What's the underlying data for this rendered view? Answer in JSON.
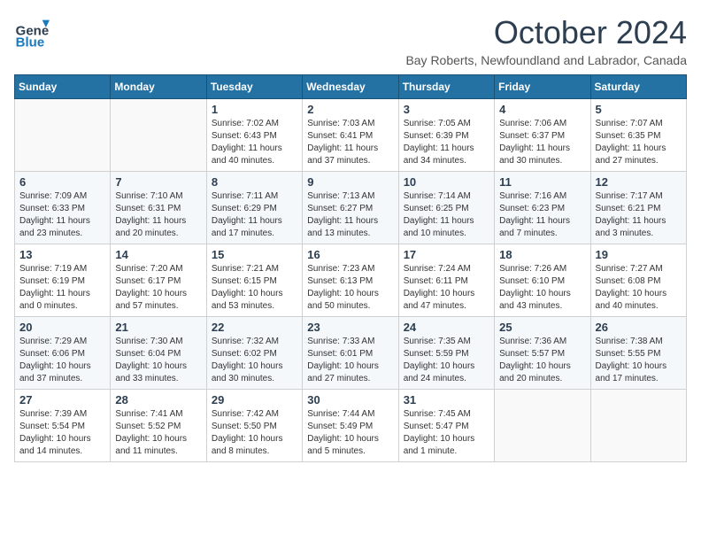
{
  "header": {
    "logo_general": "General",
    "logo_blue": "Blue",
    "month_title": "October 2024",
    "subtitle": "Bay Roberts, Newfoundland and Labrador, Canada"
  },
  "days_of_week": [
    "Sunday",
    "Monday",
    "Tuesday",
    "Wednesday",
    "Thursday",
    "Friday",
    "Saturday"
  ],
  "weeks": [
    [
      {
        "day": "",
        "info": ""
      },
      {
        "day": "",
        "info": ""
      },
      {
        "day": "1",
        "info": "Sunrise: 7:02 AM\nSunset: 6:43 PM\nDaylight: 11 hours and 40 minutes."
      },
      {
        "day": "2",
        "info": "Sunrise: 7:03 AM\nSunset: 6:41 PM\nDaylight: 11 hours and 37 minutes."
      },
      {
        "day": "3",
        "info": "Sunrise: 7:05 AM\nSunset: 6:39 PM\nDaylight: 11 hours and 34 minutes."
      },
      {
        "day": "4",
        "info": "Sunrise: 7:06 AM\nSunset: 6:37 PM\nDaylight: 11 hours and 30 minutes."
      },
      {
        "day": "5",
        "info": "Sunrise: 7:07 AM\nSunset: 6:35 PM\nDaylight: 11 hours and 27 minutes."
      }
    ],
    [
      {
        "day": "6",
        "info": "Sunrise: 7:09 AM\nSunset: 6:33 PM\nDaylight: 11 hours and 23 minutes."
      },
      {
        "day": "7",
        "info": "Sunrise: 7:10 AM\nSunset: 6:31 PM\nDaylight: 11 hours and 20 minutes."
      },
      {
        "day": "8",
        "info": "Sunrise: 7:11 AM\nSunset: 6:29 PM\nDaylight: 11 hours and 17 minutes."
      },
      {
        "day": "9",
        "info": "Sunrise: 7:13 AM\nSunset: 6:27 PM\nDaylight: 11 hours and 13 minutes."
      },
      {
        "day": "10",
        "info": "Sunrise: 7:14 AM\nSunset: 6:25 PM\nDaylight: 11 hours and 10 minutes."
      },
      {
        "day": "11",
        "info": "Sunrise: 7:16 AM\nSunset: 6:23 PM\nDaylight: 11 hours and 7 minutes."
      },
      {
        "day": "12",
        "info": "Sunrise: 7:17 AM\nSunset: 6:21 PM\nDaylight: 11 hours and 3 minutes."
      }
    ],
    [
      {
        "day": "13",
        "info": "Sunrise: 7:19 AM\nSunset: 6:19 PM\nDaylight: 11 hours and 0 minutes."
      },
      {
        "day": "14",
        "info": "Sunrise: 7:20 AM\nSunset: 6:17 PM\nDaylight: 10 hours and 57 minutes."
      },
      {
        "day": "15",
        "info": "Sunrise: 7:21 AM\nSunset: 6:15 PM\nDaylight: 10 hours and 53 minutes."
      },
      {
        "day": "16",
        "info": "Sunrise: 7:23 AM\nSunset: 6:13 PM\nDaylight: 10 hours and 50 minutes."
      },
      {
        "day": "17",
        "info": "Sunrise: 7:24 AM\nSunset: 6:11 PM\nDaylight: 10 hours and 47 minutes."
      },
      {
        "day": "18",
        "info": "Sunrise: 7:26 AM\nSunset: 6:10 PM\nDaylight: 10 hours and 43 minutes."
      },
      {
        "day": "19",
        "info": "Sunrise: 7:27 AM\nSunset: 6:08 PM\nDaylight: 10 hours and 40 minutes."
      }
    ],
    [
      {
        "day": "20",
        "info": "Sunrise: 7:29 AM\nSunset: 6:06 PM\nDaylight: 10 hours and 37 minutes."
      },
      {
        "day": "21",
        "info": "Sunrise: 7:30 AM\nSunset: 6:04 PM\nDaylight: 10 hours and 33 minutes."
      },
      {
        "day": "22",
        "info": "Sunrise: 7:32 AM\nSunset: 6:02 PM\nDaylight: 10 hours and 30 minutes."
      },
      {
        "day": "23",
        "info": "Sunrise: 7:33 AM\nSunset: 6:01 PM\nDaylight: 10 hours and 27 minutes."
      },
      {
        "day": "24",
        "info": "Sunrise: 7:35 AM\nSunset: 5:59 PM\nDaylight: 10 hours and 24 minutes."
      },
      {
        "day": "25",
        "info": "Sunrise: 7:36 AM\nSunset: 5:57 PM\nDaylight: 10 hours and 20 minutes."
      },
      {
        "day": "26",
        "info": "Sunrise: 7:38 AM\nSunset: 5:55 PM\nDaylight: 10 hours and 17 minutes."
      }
    ],
    [
      {
        "day": "27",
        "info": "Sunrise: 7:39 AM\nSunset: 5:54 PM\nDaylight: 10 hours and 14 minutes."
      },
      {
        "day": "28",
        "info": "Sunrise: 7:41 AM\nSunset: 5:52 PM\nDaylight: 10 hours and 11 minutes."
      },
      {
        "day": "29",
        "info": "Sunrise: 7:42 AM\nSunset: 5:50 PM\nDaylight: 10 hours and 8 minutes."
      },
      {
        "day": "30",
        "info": "Sunrise: 7:44 AM\nSunset: 5:49 PM\nDaylight: 10 hours and 5 minutes."
      },
      {
        "day": "31",
        "info": "Sunrise: 7:45 AM\nSunset: 5:47 PM\nDaylight: 10 hours and 1 minute."
      },
      {
        "day": "",
        "info": ""
      },
      {
        "day": "",
        "info": ""
      }
    ]
  ]
}
